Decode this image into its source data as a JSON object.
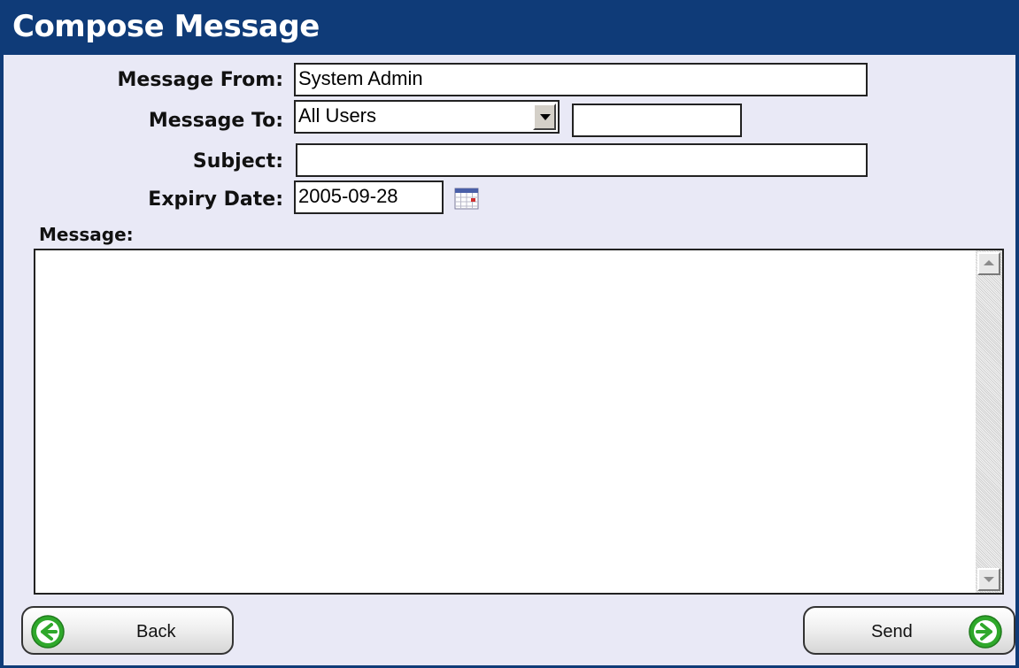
{
  "window": {
    "title": "Compose Message"
  },
  "form": {
    "from_label": "Message From:",
    "from_value": "System Admin",
    "to_label": "Message To:",
    "to_selected": "All Users",
    "to_extra_value": "",
    "subject_label": "Subject:",
    "subject_value": "",
    "expiry_label": "Expiry Date:",
    "expiry_value": "2005-09-28",
    "message_label": "Message:",
    "message_value": ""
  },
  "buttons": {
    "back_label": "Back",
    "send_label": "Send"
  },
  "icons": {
    "calendar": "calendar-icon",
    "back_arrow": "arrow-left-icon",
    "send_arrow": "arrow-right-icon",
    "dropdown": "chevron-down-icon"
  },
  "colors": {
    "title_bar": "#0f3b78",
    "panel_bg": "#e9e9f6",
    "arrow_green": "#2fa82b"
  }
}
